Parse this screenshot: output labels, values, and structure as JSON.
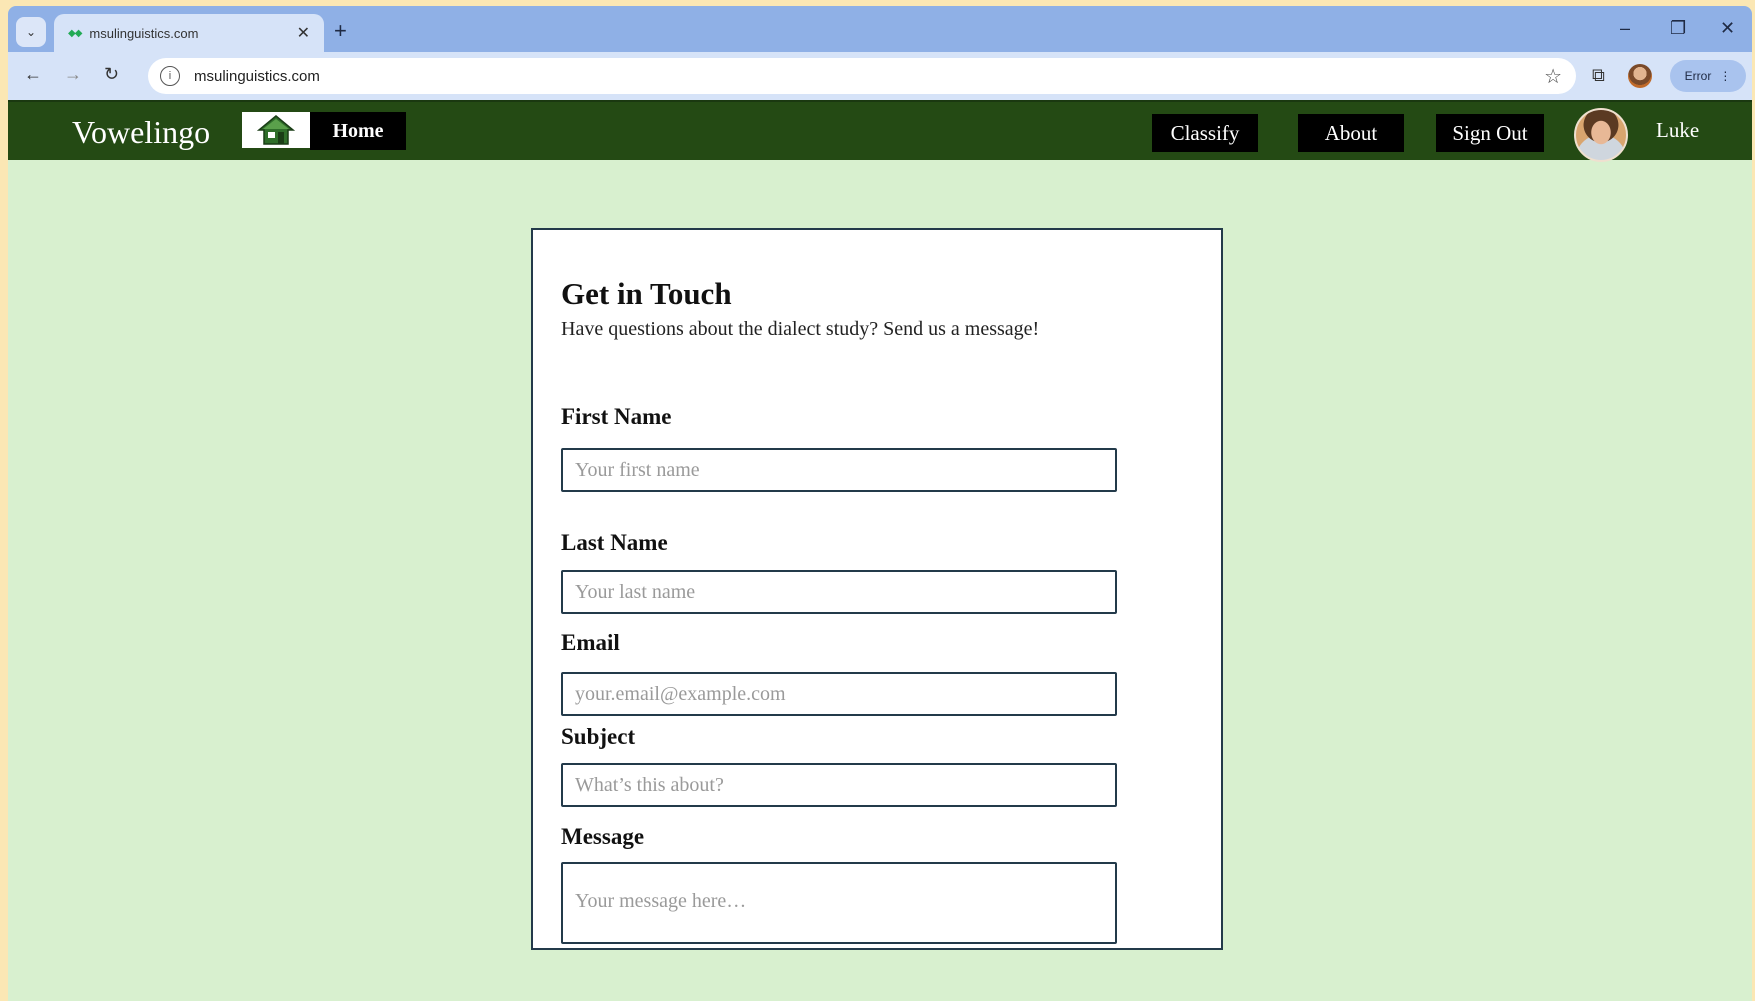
{
  "browser": {
    "tab_title": "msulinguistics.com",
    "url": "msulinguistics.com",
    "error_label": "Error"
  },
  "nav": {
    "brand": "Vowelingo",
    "home_label": "Home",
    "classify_label": "Classify",
    "about_label": "About",
    "signout_label": "Sign Out",
    "user_name": "Luke"
  },
  "form": {
    "title": "Get in Touch",
    "subtitle": "Have questions about the dialect study? Send us a message!",
    "first_name": {
      "label": "First Name",
      "placeholder": "Your first name",
      "value": ""
    },
    "last_name": {
      "label": "Last Name",
      "placeholder": "Your last name",
      "value": ""
    },
    "email": {
      "label": "Email",
      "placeholder": "your.email@example.com",
      "value": ""
    },
    "subject": {
      "label": "Subject",
      "placeholder": "What’s this about?",
      "value": ""
    },
    "message": {
      "label": "Message",
      "placeholder": "Your message here…",
      "value": ""
    }
  },
  "colors": {
    "nav_bg": "#244a14",
    "page_bg": "#d8f0cf",
    "button_bg": "#000000",
    "field_border": "#233a4a"
  }
}
